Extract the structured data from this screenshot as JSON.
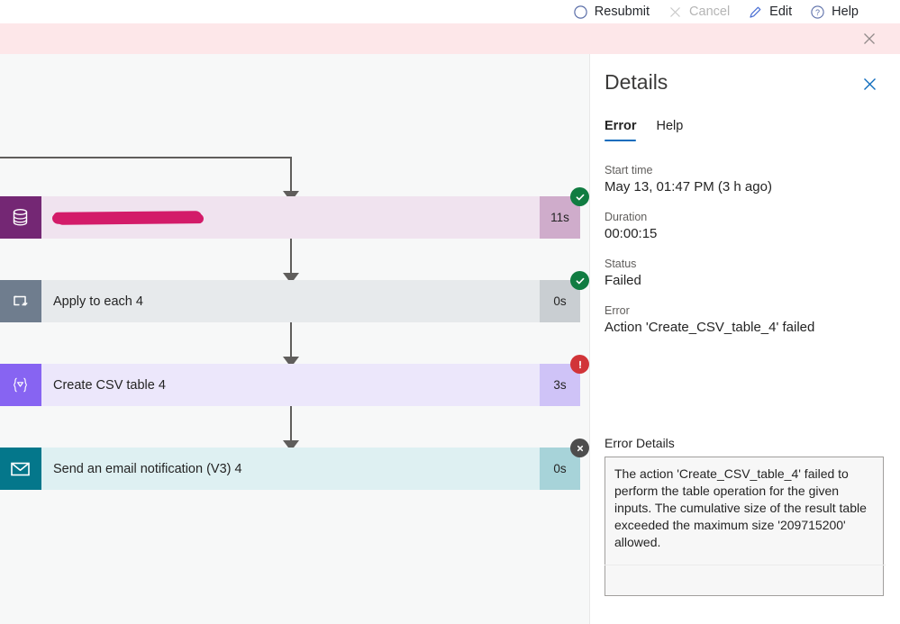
{
  "command_bar": {
    "items": [
      {
        "label": "Resubmit",
        "icon": "resubmit-icon",
        "disabled": false
      },
      {
        "label": "Cancel",
        "icon": "cancel-icon",
        "disabled": true
      },
      {
        "label": "Edit",
        "icon": "edit-pencil-icon",
        "disabled": false
      },
      {
        "label": "Help",
        "icon": "help-circle-icon",
        "disabled": false
      }
    ]
  },
  "alert_banner": {
    "message": "",
    "close_icon": "close-icon",
    "background": "#fde7e9"
  },
  "flow": {
    "cards": [
      {
        "title": "",
        "redacted": true,
        "duration": "11s",
        "status": "succeeded",
        "icon": "database-icon",
        "icon_bg": "#742774",
        "body_bg": "#f0e3ef",
        "dur_bg": "#cfaccb"
      },
      {
        "title": "Apply to each 4",
        "redacted": false,
        "duration": "0s",
        "status": "succeeded",
        "icon": "loop-repeat-icon",
        "icon_bg": "#6f7d8e",
        "body_bg": "#e7eaec",
        "dur_bg": "#c9ced2"
      },
      {
        "title": "Create CSV table 4",
        "redacted": false,
        "duration": "3s",
        "status": "failed",
        "icon": "csv-table-icon",
        "icon_bg": "#8764f2",
        "body_bg": "#ece7fb",
        "dur_bg": "#cfc3f7"
      },
      {
        "title": "Send an email notification (V3) 4",
        "redacted": false,
        "duration": "0s",
        "status": "skipped",
        "icon": "envelope-icon",
        "icon_bg": "#04778b",
        "body_bg": "#def0f2",
        "dur_bg": "#a7d3d9"
      }
    ],
    "status_colors": {
      "succeeded": "#107c41",
      "failed": "#d13438",
      "skipped": "#4d4d4d"
    }
  },
  "details": {
    "title": "Details",
    "close_icon": "close-icon",
    "tabs": [
      {
        "label": "Error",
        "active": true
      },
      {
        "label": "Help",
        "active": false
      }
    ],
    "fields": [
      {
        "label": "Start time",
        "value": "May 13, 01:47 PM (3 h ago)"
      },
      {
        "label": "Duration",
        "value": "00:00:15"
      },
      {
        "label": "Status",
        "value": "Failed"
      },
      {
        "label": "Error",
        "value": "Action 'Create_CSV_table_4' failed"
      }
    ],
    "error_details": {
      "label": "Error Details",
      "text": "The action 'Create_CSV_table_4' failed to perform the table operation for the given inputs. The cumulative size of the result table exceeded the maximum size '209715200' allowed."
    },
    "accent_color": "#0f6cbd"
  }
}
